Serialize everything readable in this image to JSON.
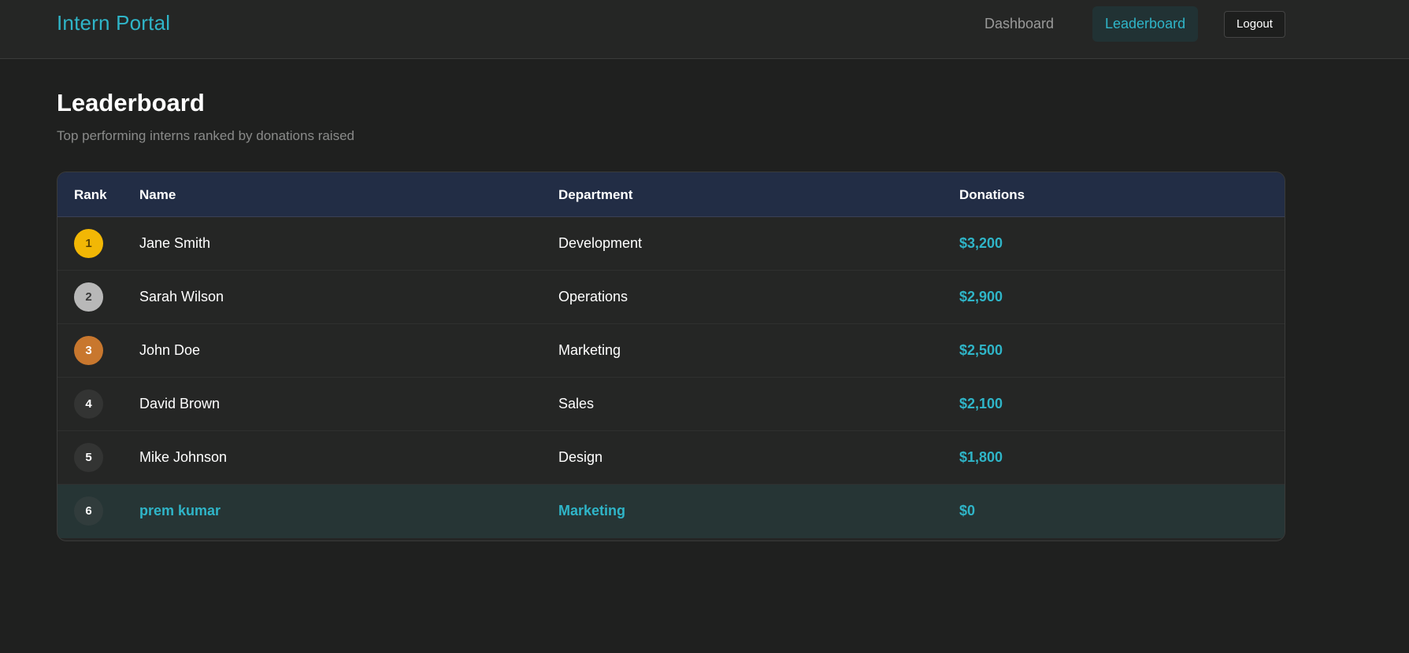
{
  "app": {
    "brand": "Intern Portal",
    "nav": [
      {
        "label": "Dashboard",
        "active": false
      },
      {
        "label": "Leaderboard",
        "active": true
      }
    ],
    "logout_label": "Logout",
    "accent_color": "#2fb5c8"
  },
  "page": {
    "title": "Leaderboard",
    "subtitle": "Top performing interns ranked by donations raised"
  },
  "table": {
    "headers": [
      "Rank",
      "Name",
      "Department",
      "Donations"
    ],
    "rows": [
      {
        "rank": "1",
        "name": "Jane Smith",
        "department": "Development",
        "donations": "$3,200",
        "badge_color": "#f2b705",
        "badge_text_color": "#5a4200"
      },
      {
        "rank": "2",
        "name": "Sarah Wilson",
        "department": "Operations",
        "donations": "$2,900",
        "badge_color": "#b8b8b8",
        "badge_text_color": "#3a3a3a"
      },
      {
        "rank": "3",
        "name": "John Doe",
        "department": "Marketing",
        "donations": "$2,500",
        "badge_color": "#c8772e",
        "badge_text_color": "#ffffff"
      },
      {
        "rank": "4",
        "name": "David Brown",
        "department": "Sales",
        "donations": "$2,100",
        "badge_color": "#333433",
        "badge_text_color": "#ffffff"
      },
      {
        "rank": "5",
        "name": "Mike Johnson",
        "department": "Design",
        "donations": "$1,800",
        "badge_color": "#333433",
        "badge_text_color": "#ffffff"
      },
      {
        "rank": "6",
        "name": "prem kumar",
        "department": "Marketing",
        "donations": "$0",
        "badge_color": "#313c3c",
        "badge_text_color": "#ffffff",
        "current_user": true
      }
    ]
  }
}
